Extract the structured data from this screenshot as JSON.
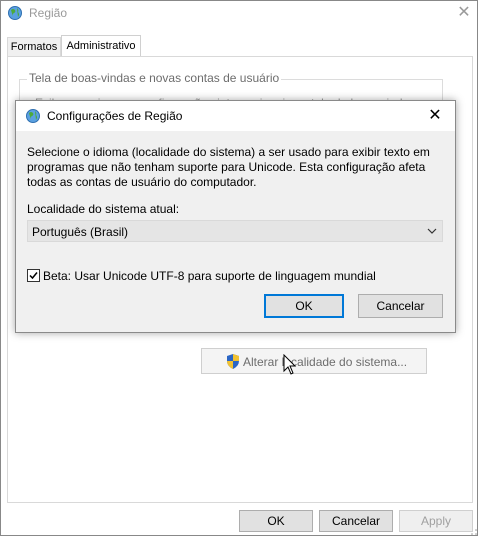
{
  "main_window": {
    "title": "Região",
    "tabs": [
      {
        "label": "Formatos",
        "active": false
      },
      {
        "label": "Administrativo",
        "active": true
      }
    ],
    "group": {
      "legend": "Tela de boas-vindas e novas contas de usuário",
      "description": "Exiba e copie suas configurações internacionais na tela de boas-vindas"
    },
    "change_locale_label": "Alterar localidade do sistema...",
    "buttons": {
      "ok": "OK",
      "cancel": "Cancelar",
      "apply": "Apply"
    }
  },
  "dialog": {
    "title": "Configurações de Região",
    "message_lines": [
      "Selecione o idioma (localidade do sistema) a ser usado para exibir texto em",
      "programas que não tenham suporte para Unicode. Esta configuração afeta",
      "todas as contas de usuário do computador."
    ],
    "current_locale_label": "Localidade do sistema atual:",
    "current_locale_value": "Português (Brasil)",
    "beta_checkbox_label": "Beta: Usar Unicode UTF-8 para suporte de linguagem mundial",
    "beta_checked": true,
    "ok_label": "OK",
    "cancel_label": "Cancelar"
  },
  "colors": {
    "accent": "#0078d7",
    "disabled_text": "#a0a0a0"
  }
}
